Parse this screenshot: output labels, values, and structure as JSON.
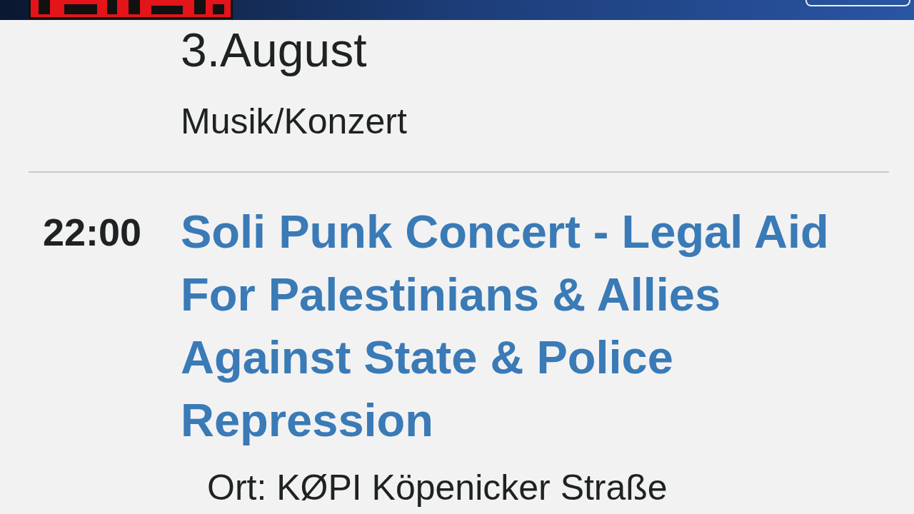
{
  "date": "3.August",
  "category": "Musik/Konzert",
  "events": [
    {
      "time": "22:00",
      "title": "Soli Punk Concert - Legal Aid For Palestinians & Allies Against State & Police Repression",
      "location": "Ort: KØPI Köpenicker Straße"
    }
  ]
}
